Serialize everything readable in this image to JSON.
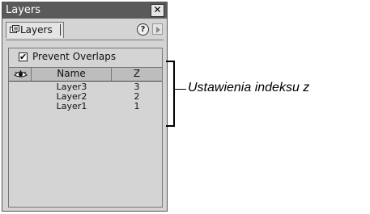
{
  "panel": {
    "title": "Layers",
    "close_glyph": "✕",
    "tab_label": "Layers",
    "tab_icon": "layers-tab-icon",
    "help_glyph": "?",
    "prevent_overlaps": {
      "label": "Prevent Overlaps",
      "checked": true,
      "mark": "✔"
    },
    "columns": {
      "visibility_icon": "eye-icon",
      "name": "Name",
      "z": "Z"
    },
    "rows": [
      {
        "name": "Layer3",
        "z": "3"
      },
      {
        "name": "Layer2",
        "z": "2"
      },
      {
        "name": "Layer1",
        "z": "1"
      }
    ]
  },
  "annotation": {
    "text": "Ustawienia indeksu z"
  }
}
